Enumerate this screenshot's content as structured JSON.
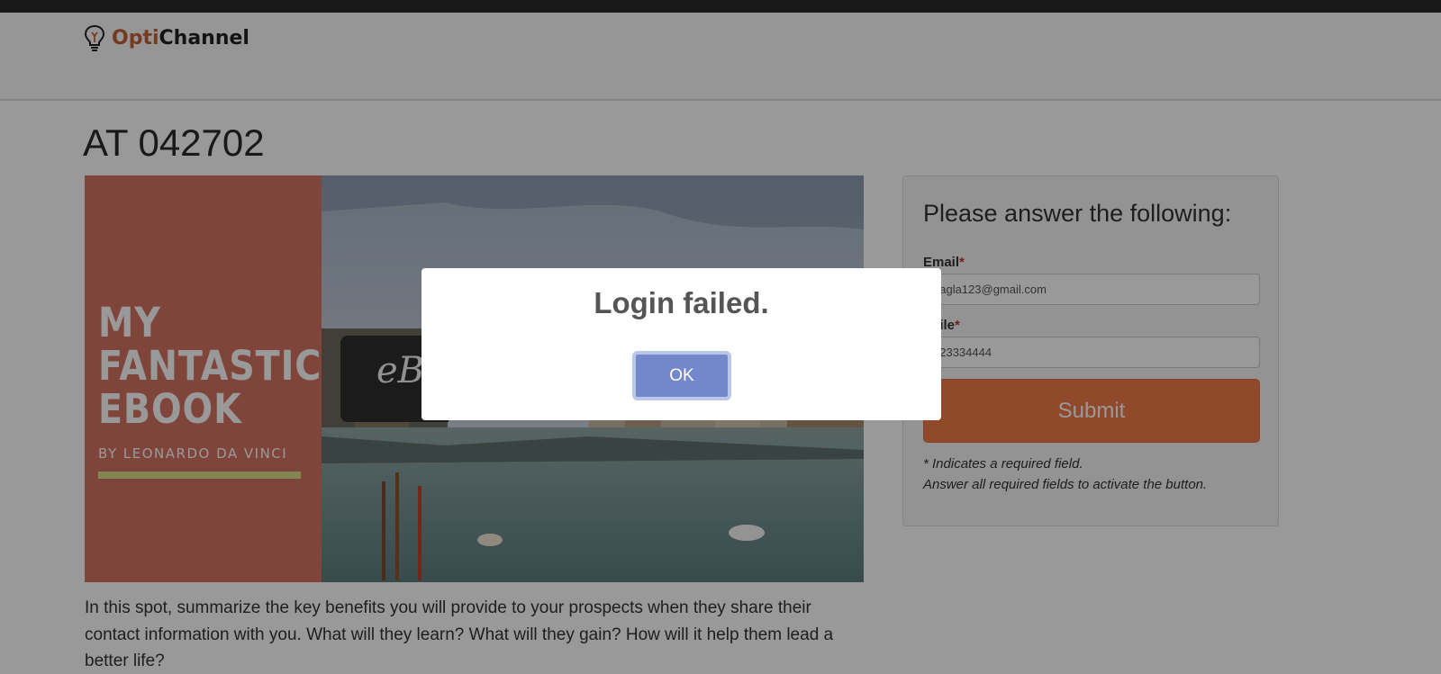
{
  "brand": {
    "name_part1": "Opti",
    "name_part2": "Channel",
    "logo_icon": "lightbulb-icon"
  },
  "page": {
    "title": "AT 042702"
  },
  "hero": {
    "title_lines": [
      "MY",
      "FANTASTIC",
      "EBOOK"
    ],
    "author": "BY LEONARDO DA VINCI",
    "badge_text": "eB",
    "panel_color": "#d57462",
    "accent_color": "#d7e08a"
  },
  "body": {
    "description": "In this spot, summarize the key benefits you will provide to your prospects when they share their contact information with you. What will they learn? What will they gain? How will it help them lead a better life?"
  },
  "form": {
    "heading": "Please answer the following:",
    "email_label": "Email",
    "email_value": "aagla123@gmail.com",
    "mobile_label": "obile",
    "mobile_value": "123334444",
    "required_mark": "*",
    "submit_label": "Submit",
    "note_required": "* Indicates a required field.",
    "note_activate": "Answer all required fields to activate the button.",
    "submit_color": "#f07b49"
  },
  "dialog": {
    "message": "Login failed.",
    "ok_label": "OK",
    "ok_color": "#7388cc"
  }
}
